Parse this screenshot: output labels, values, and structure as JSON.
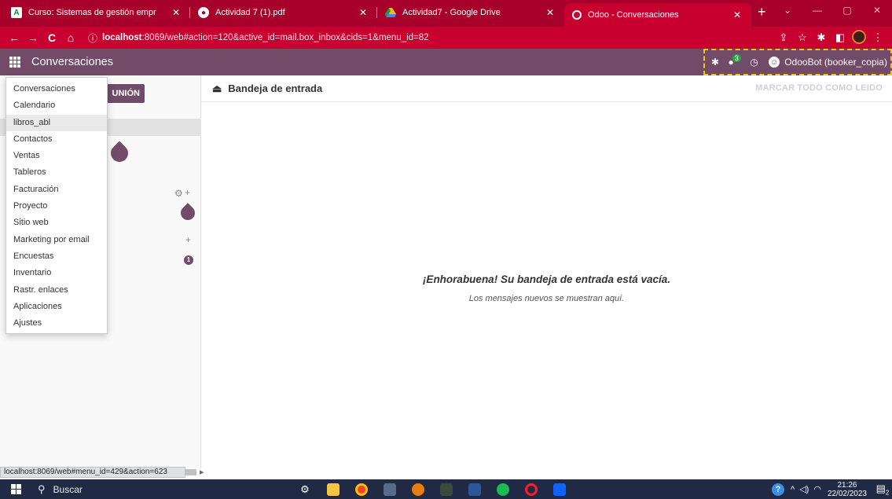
{
  "browser": {
    "tabs": [
      {
        "title": "Curso: Sistemas de gestión empr",
        "favicon": "A",
        "fav_color": "#1b7d3a",
        "active": false,
        "closable": true
      },
      {
        "title": "Actividad 7 (1).pdf",
        "favicon": "globe-icon",
        "active": false,
        "closable": true
      },
      {
        "title": "Actividad7 - Google Drive",
        "favicon": "drive-icon",
        "active": false,
        "closable": true
      },
      {
        "title": "Odoo - Conversaciones",
        "favicon": "odoo-icon",
        "active": true,
        "closable": true
      }
    ],
    "new_tab": "+",
    "url_host": "localhost",
    "url_path": ":8069/web#action=120&active_id=mail.box_inbox&cids=1&menu_id=82"
  },
  "odoo": {
    "app_name": "Conversaciones",
    "systray": {
      "chat_count": "3",
      "user": "OdooBot (booker_copia)"
    }
  },
  "sidebar": {
    "meeting_label": "UNIÓN"
  },
  "app_menu": {
    "items": [
      "Conversaciones",
      "Calendario",
      "libros_abl",
      "Contactos",
      "Ventas",
      "Tableros",
      "Facturación",
      "Proyecto",
      "Sitio web",
      "Marketing por email",
      "Encuestas",
      "Inventario",
      "Rastr. enlaces",
      "Aplicaciones",
      "Ajustes"
    ],
    "active_index": 2
  },
  "content": {
    "title": "Bandeja de entrada",
    "mark_all": "MARCAR TODO COMO LEIDO",
    "empty_title": "¡Enhorabuena! Su bandeja de entrada está vacía.",
    "empty_subtitle": "Los mensajes nuevos se muestran aquí.",
    "sidebar_badge": "1"
  },
  "status_link": "localhost:8069/web#menu_id=429&action=623",
  "taskbar": {
    "search_label": "Buscar",
    "time": "21:26",
    "date": "22/02/2023",
    "notif_count": "2"
  },
  "colors": {
    "browser_frame": "#c8002f",
    "odoo_primary": "#714b67",
    "taskbar": "#202a44"
  }
}
